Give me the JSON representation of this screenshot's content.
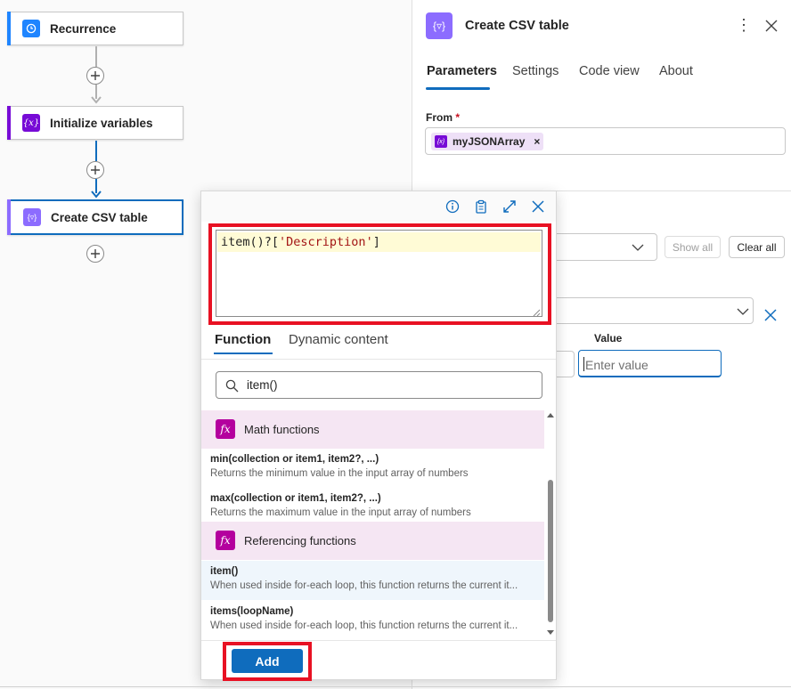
{
  "canvas": {
    "nodes": [
      {
        "label": "Recurrence",
        "icon": "clock-icon",
        "color": "#1f85ff"
      },
      {
        "label": "Initialize variables",
        "icon": "variable-icon",
        "color": "#770bd6"
      },
      {
        "label": "Create CSV table",
        "icon": "data-operation-icon",
        "color": "#8c6cff"
      }
    ]
  },
  "panel": {
    "title": "Create CSV table",
    "tabs": [
      "Parameters",
      "Settings",
      "Code view",
      "About"
    ],
    "active_tab": "Parameters",
    "from_label": "From",
    "required_mark": "*",
    "from_token": "myJSONArray",
    "token_remove": "×",
    "show_all": "Show all",
    "clear_all": "Clear all",
    "value_label": "Value",
    "value_placeholder": "Enter value"
  },
  "popup": {
    "expression_fn": "item()?[",
    "expression_str": "'Description'",
    "expression_end": "]",
    "tabs": [
      "Function",
      "Dynamic content"
    ],
    "search_value": "item()",
    "fx_glyph": "fx",
    "categories": [
      {
        "name": "Math functions",
        "functions": [
          {
            "name": "min(collection or item1, item2?, ...)",
            "desc": "Returns the minimum value in the input array of numbers"
          },
          {
            "name": "max(collection or item1, item2?, ...)",
            "desc": "Returns the maximum value in the input array of numbers"
          }
        ]
      },
      {
        "name": "Referencing functions",
        "functions": [
          {
            "name": "item()",
            "desc": "When used inside for-each loop, this function returns the current it..."
          },
          {
            "name": "items(loopName)",
            "desc": "When used inside for-each loop, this function returns the current it..."
          }
        ]
      }
    ],
    "add_label": "Add"
  },
  "colors": {
    "accent": "#0f6cbd",
    "highlight": "#e81123",
    "fx": "#b4009e"
  }
}
